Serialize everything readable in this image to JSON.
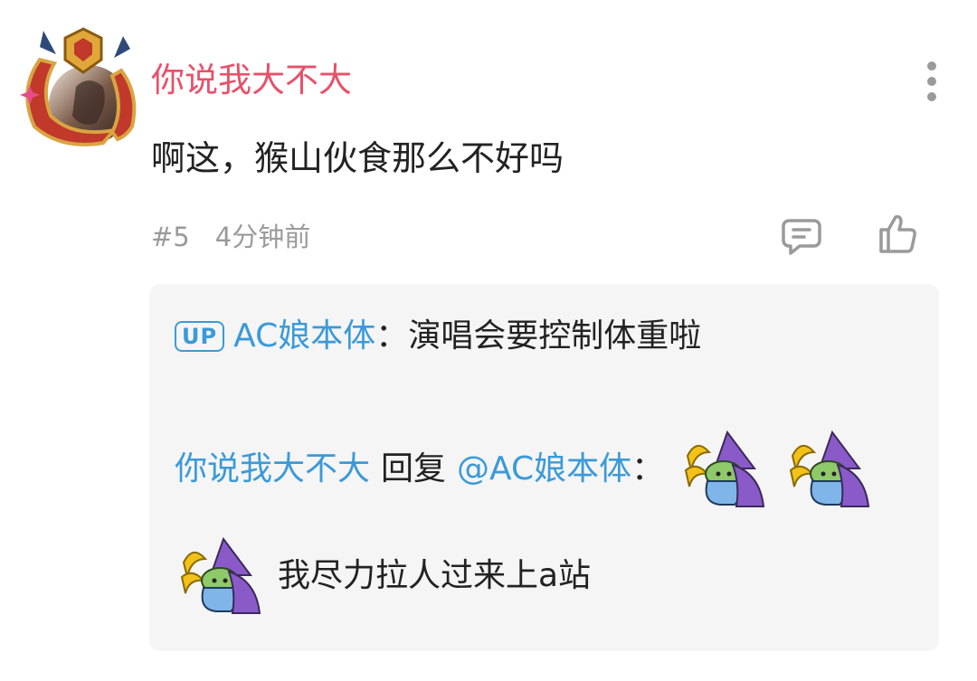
{
  "comment": {
    "username": "你说我大不大",
    "text": "啊这，猴山伙食那么不好吗",
    "floor": "#5",
    "time": "4分钟前"
  },
  "replies": [
    {
      "badge": "UP",
      "author": "AC娘本体",
      "separator": "：",
      "text": "演唱会要控制体重啦"
    },
    {
      "author": "你说我大不大",
      "reply_word": "回复",
      "mention": "@AC娘本体",
      "separator": "：",
      "emoji_icon": "hug-goblin-sticker",
      "text": "我尽力拉人过来上a站"
    }
  ],
  "icons": [
    "more-vertical-icon",
    "reply-icon",
    "thumbs-up-icon",
    "hug-goblin-sticker"
  ],
  "colors": {
    "username": "#e8506a",
    "link": "#3a9ad9",
    "meta": "#9a9a9a",
    "reply_bg": "#f5f5f6"
  }
}
